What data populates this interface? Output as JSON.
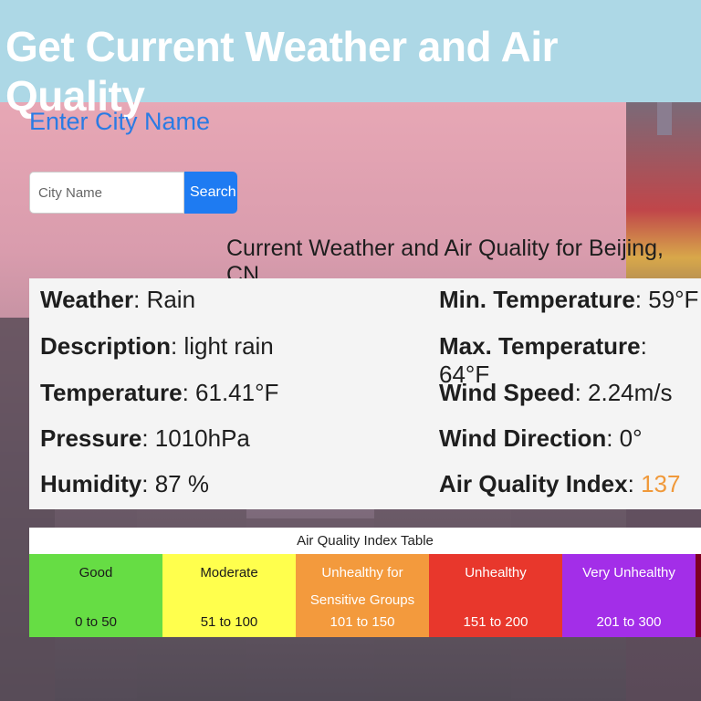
{
  "header": {
    "title": "Get Current Weather and Air Quality"
  },
  "search": {
    "label": "Enter City Name",
    "placeholder": "City Name",
    "button_label": "Search"
  },
  "current": {
    "title": "Current Weather and Air Quality for Beijing, CN"
  },
  "weather": {
    "left": [
      {
        "key": "Weather",
        "value": "Rain"
      },
      {
        "key": "Description",
        "value": "light rain"
      },
      {
        "key": "Temperature",
        "value": "61.41°F"
      },
      {
        "key": "Pressure",
        "value": "1010hPa"
      },
      {
        "key": "Humidity",
        "value": "87 %"
      }
    ],
    "right": [
      {
        "key": "Min. Temperature",
        "value": "59°F"
      },
      {
        "key": "Max. Temperature",
        "value": "64°F"
      },
      {
        "key": "Wind Speed",
        "value": "2.24m/s"
      },
      {
        "key": "Wind Direction",
        "value": "0°"
      },
      {
        "key": "Air Quality Index",
        "value": "137"
      }
    ]
  },
  "aqi_table": {
    "caption": "Air Quality Index Table",
    "levels": [
      {
        "label": "Good",
        "range": "0 to 50",
        "color": "#66dd44",
        "text_color": "#1a1a1a"
      },
      {
        "label": "Moderate",
        "range": "51 to 100",
        "color": "#ffff4d",
        "text_color": "#1a1a1a"
      },
      {
        "label": "Unhealthy for Sensitive Groups",
        "range": "101 to 150",
        "color": "#f39a3d",
        "text_color": "#ffffff"
      },
      {
        "label": "Unhealthy",
        "range": "151 to 200",
        "color": "#e8372c",
        "text_color": "#ffffff"
      },
      {
        "label": "Very Unhealthy",
        "range": "201 to 300",
        "color": "#a32ee8",
        "text_color": "#ffffff"
      }
    ]
  },
  "colors": {
    "header_bg": "#add8e6",
    "accent": "#1e7bf2",
    "aqi_highlight": "#f0993a"
  }
}
